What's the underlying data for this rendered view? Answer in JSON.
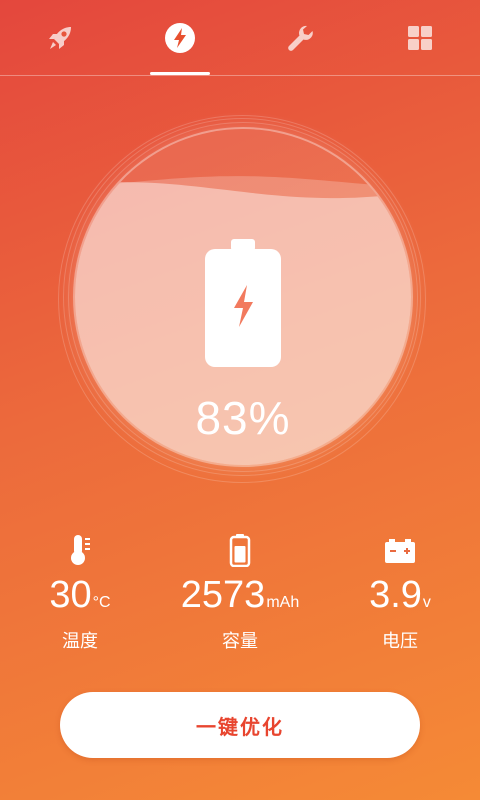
{
  "tabs": [
    {
      "id": "boost",
      "icon": "rocket-icon",
      "active": false
    },
    {
      "id": "battery",
      "icon": "lightning-icon",
      "active": true
    },
    {
      "id": "tools",
      "icon": "wrench-icon",
      "active": false
    },
    {
      "id": "apps",
      "icon": "grid-icon",
      "active": false
    }
  ],
  "battery": {
    "percent": 83,
    "percent_text": "83%",
    "icon": "battery-charging-icon"
  },
  "stats": {
    "temperature": {
      "value": "30",
      "unit": "°C",
      "label": "温度",
      "icon": "thermometer-icon"
    },
    "capacity": {
      "value": "2573",
      "unit": "mAh",
      "label": "容量",
      "icon": "battery-small-icon"
    },
    "voltage": {
      "value": "3.9",
      "unit": "v",
      "label": "电压",
      "icon": "car-battery-icon"
    }
  },
  "optimize_button": {
    "label": "一键优化"
  },
  "colors": {
    "accent": "#e8452f",
    "gradient_top": "#e4473d",
    "gradient_bottom": "#f58a36"
  }
}
